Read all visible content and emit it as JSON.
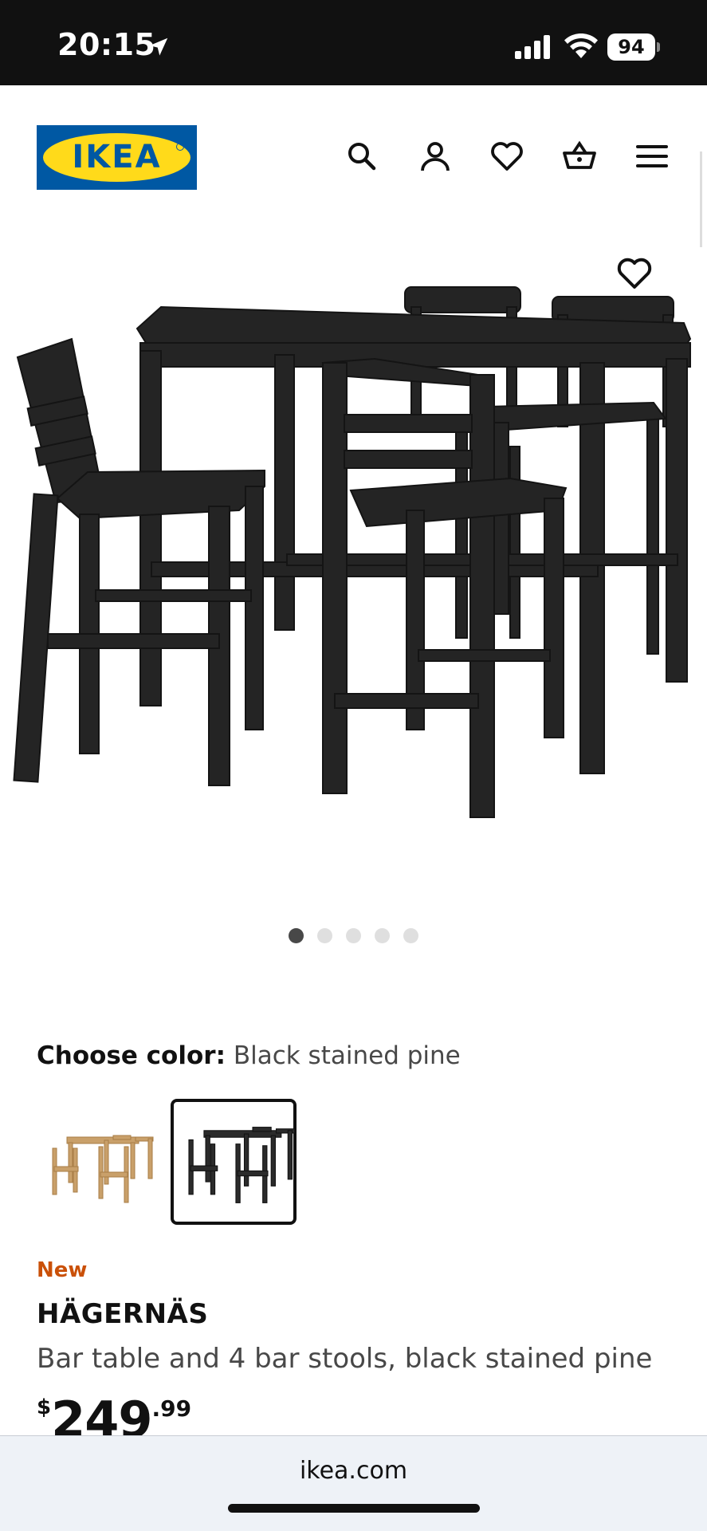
{
  "status_bar": {
    "time": "20:15",
    "battery": "94",
    "icons": [
      "location-arrow-icon",
      "signal-icon",
      "wifi-icon",
      "battery-icon"
    ]
  },
  "header": {
    "logo_text": "IKEA",
    "icons": [
      "search-icon",
      "account-icon",
      "favorites-icon",
      "cart-icon",
      "menu-icon"
    ],
    "brand_colors": {
      "blue": "#0058a3",
      "yellow": "#ffda1a"
    }
  },
  "gallery": {
    "image_count": 5,
    "active_index": 0
  },
  "color_chooser": {
    "label": "Choose color:",
    "selected_value": "Black stained pine",
    "options": [
      "pine",
      "black-stained-pine"
    ],
    "selected_index": 1
  },
  "product": {
    "badge": "New",
    "name": "HÄGERNÄS",
    "description": "Bar table and 4 bar stools, black stained pine",
    "price_currency": "$",
    "price_integer": "249",
    "price_decimal": ".99",
    "badge_color": "#ca5008"
  },
  "browser": {
    "url": "ikea.com"
  }
}
